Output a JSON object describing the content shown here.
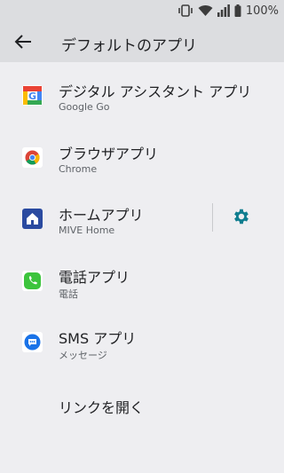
{
  "status": {
    "battery_text": "100%"
  },
  "appbar": {
    "title": "デフォルトのアプリ"
  },
  "rows": [
    {
      "title": "デジタル アシスタント アプリ",
      "subtitle": "Google Go"
    },
    {
      "title": "ブラウザアプリ",
      "subtitle": "Chrome"
    },
    {
      "title": "ホームアプリ",
      "subtitle": "MIVE Home"
    },
    {
      "title": "電話アプリ",
      "subtitle": "電話"
    },
    {
      "title": "SMS アプリ",
      "subtitle": "メッセージ"
    },
    {
      "title": "リンクを開く"
    }
  ],
  "colors": {
    "accent": "#0f7d8f",
    "appbar_bg": "#dcdde0",
    "page_bg": "#eeeef1"
  }
}
